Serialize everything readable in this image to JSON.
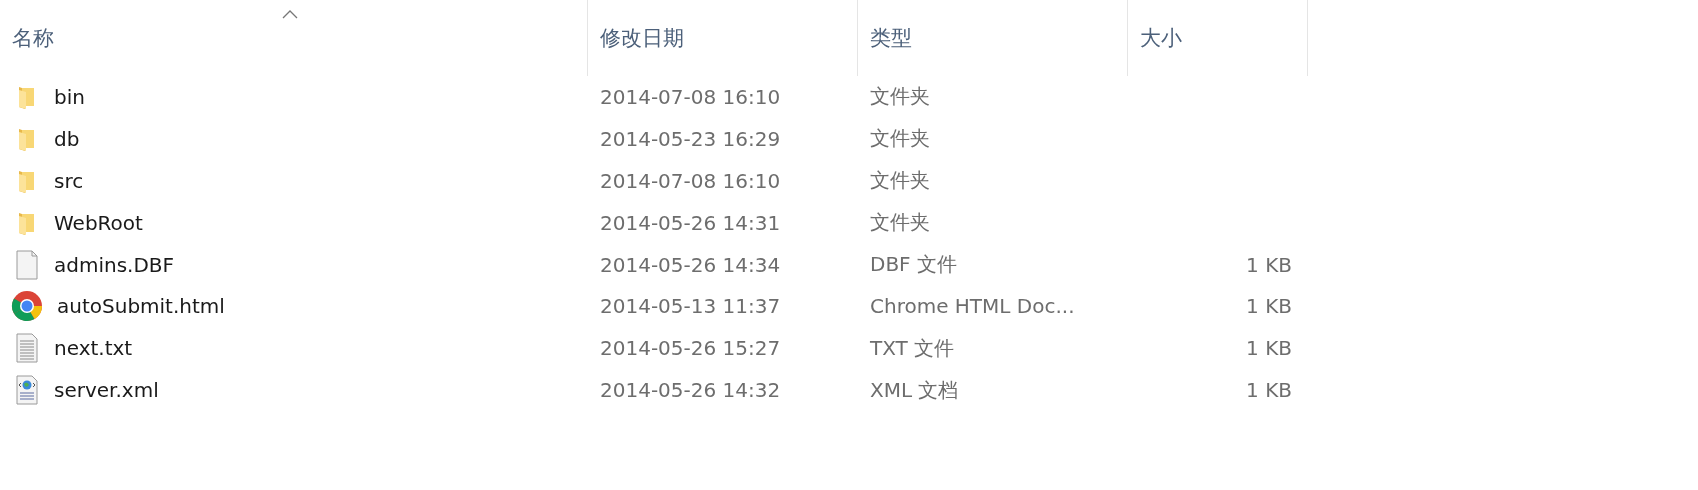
{
  "columns": [
    {
      "label": "名称",
      "sorted": true
    },
    {
      "label": "修改日期",
      "sorted": false
    },
    {
      "label": "类型",
      "sorted": false
    },
    {
      "label": "大小",
      "sorted": false
    }
  ],
  "files": [
    {
      "name": "bin",
      "kind": "folder",
      "modified": "2014-07-08 16:10",
      "type": "文件夹"
    },
    {
      "name": "db",
      "kind": "folder",
      "modified": "2014-05-23 16:29",
      "type": "文件夹"
    },
    {
      "name": "src",
      "kind": "folder",
      "modified": "2014-07-08 16:10",
      "type": "文件夹"
    },
    {
      "name": "WebRoot",
      "kind": "folder",
      "modified": "2014-05-26 14:31",
      "type": "文件夹"
    },
    {
      "name": "admins.DBF",
      "kind": "file",
      "modified": "2014-05-26 14:34",
      "type": "DBF 文件",
      "size": "1 KB"
    },
    {
      "name": "autoSubmit.html",
      "kind": "chrome",
      "modified": "2014-05-13 11:37",
      "type": "Chrome HTML Doc...",
      "size": "1 KB"
    },
    {
      "name": "next.txt",
      "kind": "text",
      "modified": "2014-05-26 15:27",
      "type": "TXT 文件",
      "size": "1 KB"
    },
    {
      "name": "server.xml",
      "kind": "xml",
      "modified": "2014-05-26 14:32",
      "type": "XML 文档",
      "size": "1 KB"
    }
  ]
}
